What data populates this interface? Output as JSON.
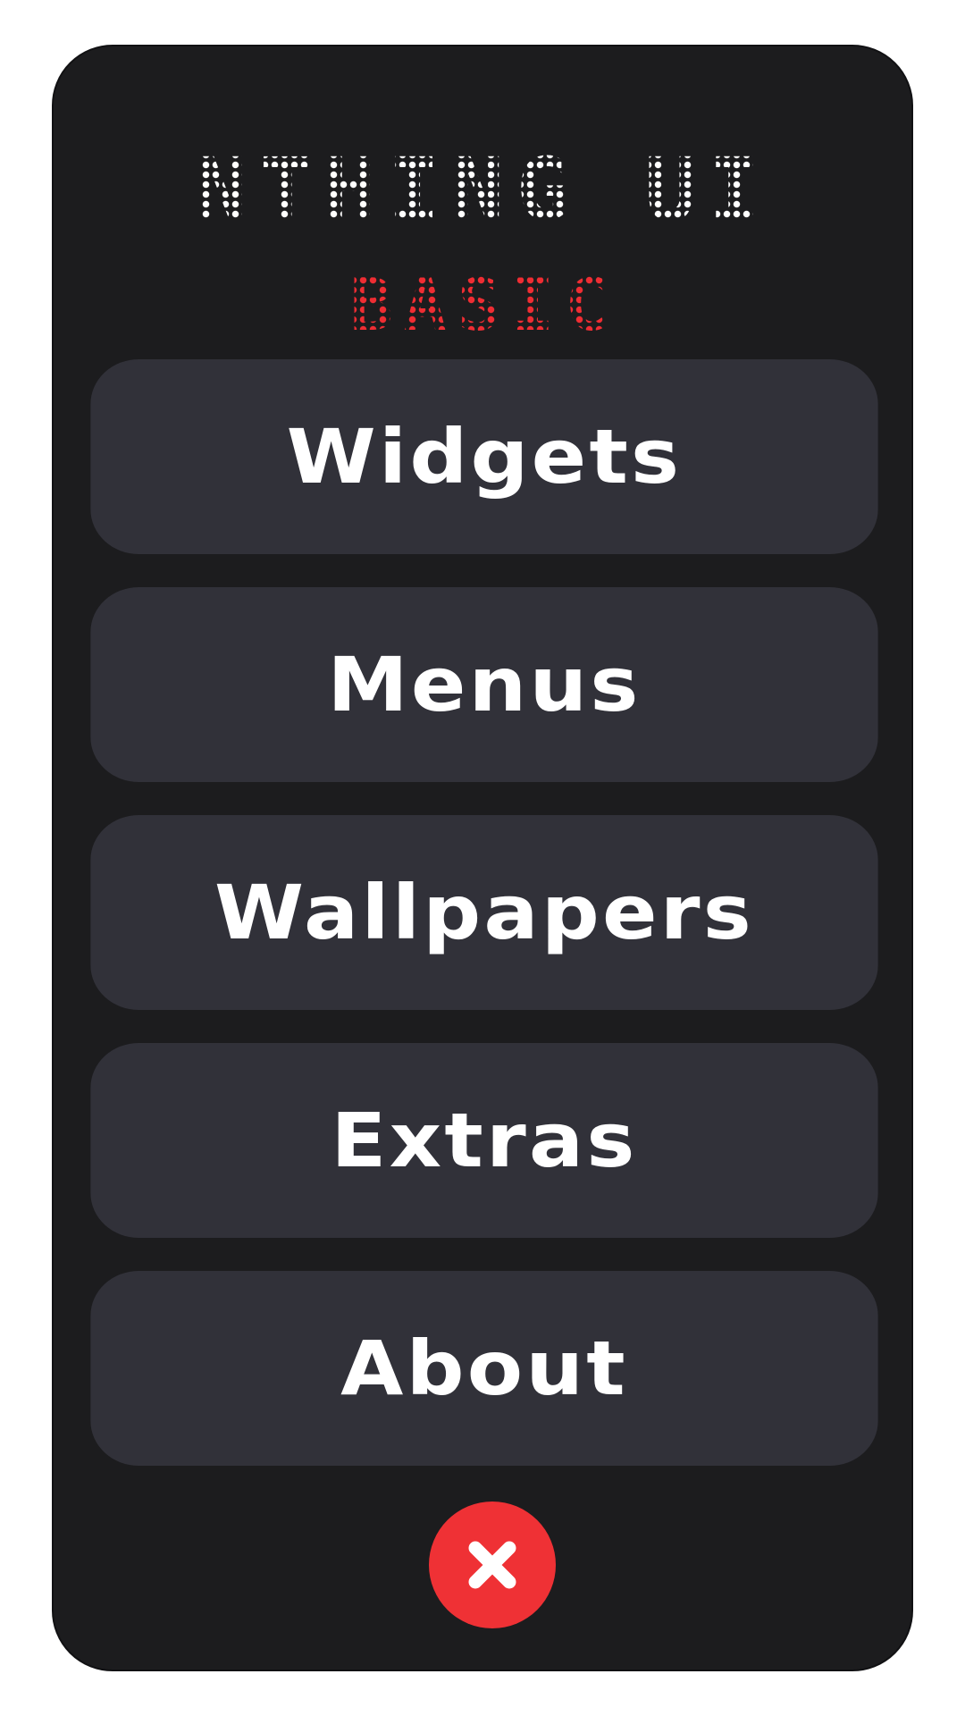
{
  "app": {
    "title": "NTHING UI",
    "subtitle": "BASIC"
  },
  "menu": {
    "items": [
      {
        "label": "Widgets"
      },
      {
        "label": "Menus"
      },
      {
        "label": "Wallpapers"
      },
      {
        "label": "Extras"
      },
      {
        "label": "About"
      }
    ]
  },
  "close": {
    "icon": "close-icon"
  },
  "colors": {
    "panel": "#1c1c1e",
    "button": "#313139",
    "accent": "#ef2d33",
    "text": "#ffffff"
  }
}
